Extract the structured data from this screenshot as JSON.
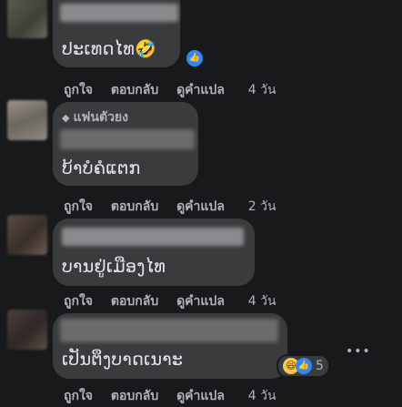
{
  "comments": [
    {
      "text": "ປະເທດໄທ🤣",
      "has_inline_like": true
    },
    {
      "badge": "แฟนตัวยง",
      "text": "ບ້າບໍຄໍແຕກ"
    },
    {
      "text": "ບານຢູ່ເມືອງໄທ"
    },
    {
      "text": "ເປັນຕຶງບາດເນາະ",
      "reaction_count": "5"
    }
  ],
  "actions": {
    "like": "ถูกใจ",
    "reply": "ตอบกลับ",
    "translate": "ดูคำแปล"
  },
  "times": [
    "4 วัน",
    "2 วัน",
    "4 วัน",
    "4 วัน"
  ],
  "icons": {
    "like": "thumbs-up-icon",
    "haha": "haha-emoji-icon",
    "gem": "diamond-icon",
    "more": "more-dots-icon"
  },
  "colors": {
    "background": "#18191a",
    "bubble": "#3a3b3c",
    "text": "#e4e6eb",
    "secondary": "#b0b3b8",
    "like_blue": "#2d88ff"
  }
}
